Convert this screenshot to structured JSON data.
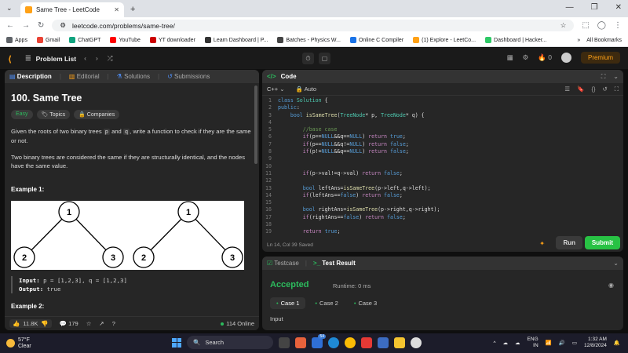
{
  "browser": {
    "tab_title": "Same Tree - LeetCode",
    "url": "leetcode.com/problems/same-tree/",
    "bookmarks": [
      "Apps",
      "Gmail",
      "ChatGPT",
      "YouTube",
      "YT downloader",
      "Learn Dashboard | P...",
      "Batches - Physics W...",
      "Online C Compiler",
      "(1) Explore - LeetCo...",
      "Dashboard | Hacker..."
    ],
    "bookmark_colors": [
      "#5f6368",
      "#ea4335",
      "#10a37f",
      "#ff0000",
      "#cc0000",
      "#333333",
      "#444444",
      "#1a73e8",
      "#ffa116",
      "#2ec866"
    ],
    "all_bookmarks": "All Bookmarks"
  },
  "nav": {
    "problem_list": "Problem List",
    "streak": "0",
    "premium": "Premium"
  },
  "left": {
    "tabs": [
      "Description",
      "Editorial",
      "Solutions",
      "Submissions"
    ],
    "title": "100. Same Tree",
    "tag_easy": "Easy",
    "tag_topics": "Topics",
    "tag_companies": "Companies",
    "desc1_a": "Given the roots of two binary trees ",
    "desc1_p": "p",
    "desc1_b": " and ",
    "desc1_q": "q",
    "desc1_c": ", write a function to check if they are the same or not.",
    "desc2": "Two binary trees are considered the same if they are structurally identical, and the nodes have the same value.",
    "example1": "Example 1:",
    "tree_labels": [
      "1",
      "2",
      "3",
      "1",
      "2",
      "3"
    ],
    "input_label": "Input:",
    "input_value": " p = [1,2,3], q = [1,2,3]",
    "output_label": "Output:",
    "output_value": " true",
    "example2": "Example 2:",
    "likes": "11.8K",
    "comments": "179",
    "online": "114 Online"
  },
  "code": {
    "panel_title": "Code",
    "language": "C++",
    "mode": "Auto",
    "status": "Ln 14, Col 39   Saved",
    "run": "Run",
    "submit": "Submit",
    "lines": [
      {
        "n": "1",
        "t": [
          [
            "kw",
            "class "
          ],
          [
            "ty",
            "Solution"
          ],
          [
            "tx",
            " {"
          ]
        ]
      },
      {
        "n": "2",
        "t": [
          [
            "kw",
            "public"
          ],
          [
            "tx",
            ":"
          ]
        ]
      },
      {
        "n": "3",
        "t": [
          [
            "tx",
            "    "
          ],
          [
            "kw",
            "bool "
          ],
          [
            "fn",
            "isSameTree"
          ],
          [
            "tx",
            "("
          ],
          [
            "ty",
            "TreeNode"
          ],
          [
            "tx",
            "* p, "
          ],
          [
            "ty",
            "TreeNode"
          ],
          [
            "tx",
            "* q) {"
          ]
        ]
      },
      {
        "n": "4",
        "t": [
          [
            "tx",
            ""
          ]
        ]
      },
      {
        "n": "5",
        "t": [
          [
            "tx",
            "        "
          ],
          [
            "cm",
            "//base case"
          ]
        ]
      },
      {
        "n": "6",
        "t": [
          [
            "tx",
            "        "
          ],
          [
            "nl",
            "if"
          ],
          [
            "tx",
            "(p=="
          ],
          [
            "kw",
            "NULL"
          ],
          [
            "tx",
            "&&q=="
          ],
          [
            "kw",
            "NULL"
          ],
          [
            "tx",
            ") "
          ],
          [
            "nl",
            "return "
          ],
          [
            "kw",
            "true"
          ],
          [
            "tx",
            ";"
          ]
        ]
      },
      {
        "n": "7",
        "t": [
          [
            "tx",
            "        "
          ],
          [
            "nl",
            "if"
          ],
          [
            "tx",
            "(p=="
          ],
          [
            "kw",
            "NULL"
          ],
          [
            "tx",
            "&&q!="
          ],
          [
            "kw",
            "NULL"
          ],
          [
            "tx",
            ") "
          ],
          [
            "nl",
            "return "
          ],
          [
            "kw",
            "false"
          ],
          [
            "tx",
            ";"
          ]
        ]
      },
      {
        "n": "8",
        "t": [
          [
            "tx",
            "        "
          ],
          [
            "nl",
            "if"
          ],
          [
            "tx",
            "(p!="
          ],
          [
            "kw",
            "NULL"
          ],
          [
            "tx",
            "&&q=="
          ],
          [
            "kw",
            "NULL"
          ],
          [
            "tx",
            ") "
          ],
          [
            "nl",
            "return "
          ],
          [
            "kw",
            "false"
          ],
          [
            "tx",
            ";"
          ]
        ]
      },
      {
        "n": "9",
        "t": [
          [
            "tx",
            ""
          ]
        ]
      },
      {
        "n": "10",
        "t": [
          [
            "tx",
            ""
          ]
        ]
      },
      {
        "n": "11",
        "t": [
          [
            "tx",
            "        "
          ],
          [
            "nl",
            "if"
          ],
          [
            "tx",
            "(p->val!=q->val) "
          ],
          [
            "nl",
            "return "
          ],
          [
            "kw",
            "false"
          ],
          [
            "tx",
            ";"
          ]
        ]
      },
      {
        "n": "12",
        "t": [
          [
            "tx",
            ""
          ]
        ]
      },
      {
        "n": "13",
        "t": [
          [
            "tx",
            "        "
          ],
          [
            "kw",
            "bool "
          ],
          [
            "tx",
            "leftAns="
          ],
          [
            "fn",
            "isSameTree"
          ],
          [
            "tx",
            "(p->left,q->left);"
          ]
        ]
      },
      {
        "n": "14",
        "t": [
          [
            "tx",
            "        "
          ],
          [
            "nl",
            "if"
          ],
          [
            "tx",
            "(leftAns=="
          ],
          [
            "kw",
            "false"
          ],
          [
            "tx",
            ") "
          ],
          [
            "nl",
            "return "
          ],
          [
            "kw",
            "false"
          ],
          [
            "tx",
            ";"
          ]
        ]
      },
      {
        "n": "15",
        "t": [
          [
            "tx",
            ""
          ]
        ]
      },
      {
        "n": "16",
        "t": [
          [
            "tx",
            "        "
          ],
          [
            "kw",
            "bool "
          ],
          [
            "tx",
            "rightAns="
          ],
          [
            "fn",
            "isSameTree"
          ],
          [
            "tx",
            "(p->right,q->right);"
          ]
        ]
      },
      {
        "n": "17",
        "t": [
          [
            "tx",
            "        "
          ],
          [
            "nl",
            "if"
          ],
          [
            "tx",
            "(rightAns=="
          ],
          [
            "kw",
            "false"
          ],
          [
            "tx",
            ") "
          ],
          [
            "nl",
            "return "
          ],
          [
            "kw",
            "false"
          ],
          [
            "tx",
            ";"
          ]
        ]
      },
      {
        "n": "18",
        "t": [
          [
            "tx",
            ""
          ]
        ]
      },
      {
        "n": "19",
        "t": [
          [
            "tx",
            "        "
          ],
          [
            "nl",
            "return "
          ],
          [
            "kw",
            "true"
          ],
          [
            "tx",
            ";"
          ]
        ]
      }
    ]
  },
  "result": {
    "tab_testcase": "Testcase",
    "tab_result": "Test Result",
    "status": "Accepted",
    "runtime": "Runtime: 0 ms",
    "cases": [
      "Case 1",
      "Case 2",
      "Case 3"
    ],
    "input_label": "Input"
  },
  "taskbar": {
    "temp": "57°F",
    "weather": "Clear",
    "search": "Search",
    "lang": "ENG",
    "region": "IN",
    "time": "1:32 AM",
    "date": "12/8/2024",
    "notif_badge": "54"
  }
}
